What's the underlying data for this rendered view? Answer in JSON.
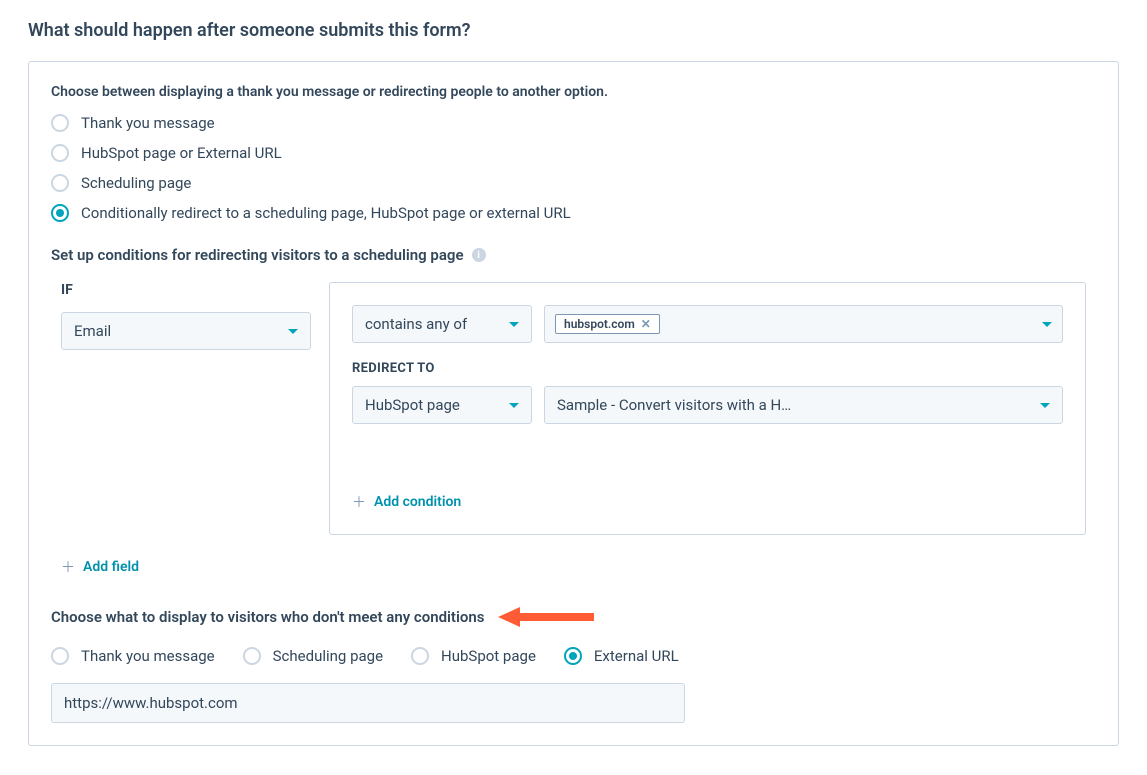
{
  "title": "What should happen after someone submits this form?",
  "chooseLabel": "Choose between displaying a thank you message or redirecting people to another option.",
  "options": {
    "thankYou": "Thank you message",
    "hubspotOrExternal": "HubSpot page or External URL",
    "scheduling": "Scheduling page",
    "conditional": "Conditionally redirect to a scheduling page, HubSpot page or external URL"
  },
  "setupHeader": "Set up conditions for redirecting visitors to a scheduling page",
  "condition": {
    "ifLabel": "IF",
    "field": "Email",
    "operator": "contains any of",
    "tag": "hubspot.com",
    "redirectLabel": "REDIRECT TO",
    "redirectType": "HubSpot page",
    "redirectPage": "Sample - Convert visitors with a H…",
    "addCondition": "Add condition"
  },
  "addField": "Add field",
  "fallback": {
    "header": "Choose what to display to visitors who don't meet any conditions",
    "options": {
      "thankYou": "Thank you message",
      "scheduling": "Scheduling page",
      "hubspot": "HubSpot page",
      "external": "External URL"
    },
    "url": "https://www.hubspot.com"
  }
}
